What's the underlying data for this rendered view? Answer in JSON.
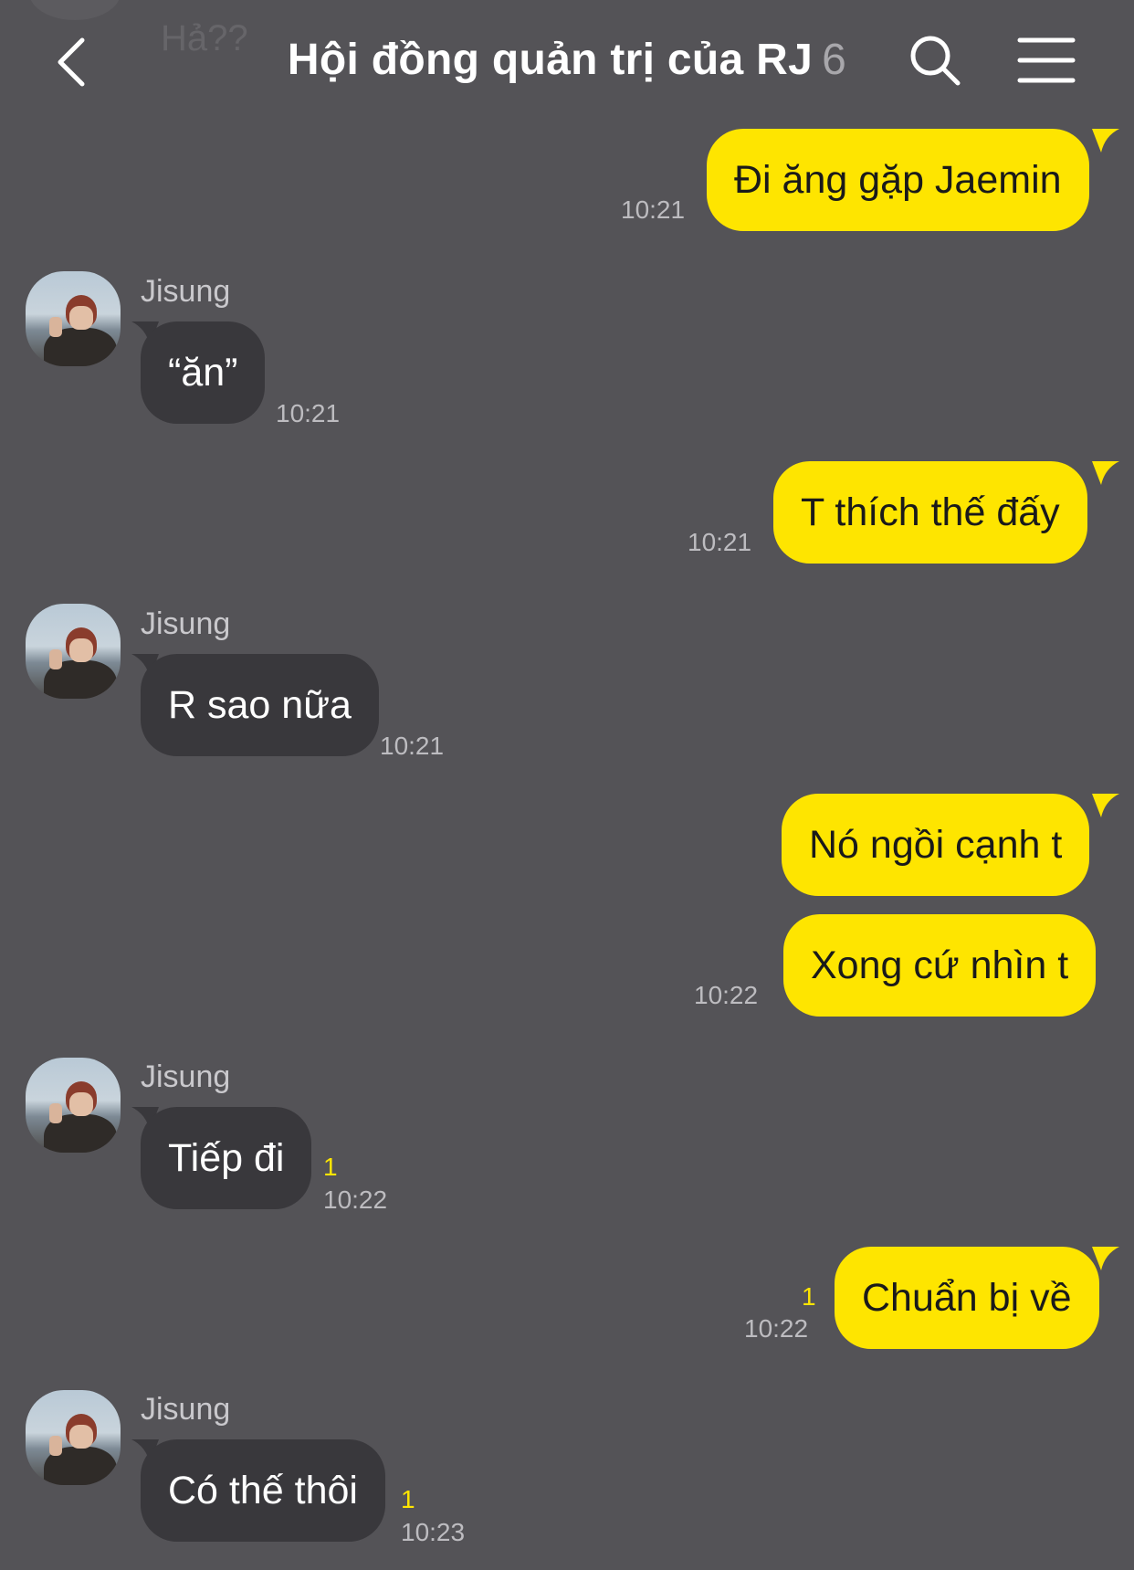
{
  "header": {
    "title": "Hội đồng quản trị của RJ",
    "member_count": "6",
    "ghost_previous_message": "Hả??"
  },
  "messages": [
    {
      "dir": "out",
      "text": "Đi ăng gặp Jaemin",
      "time": "10:21"
    },
    {
      "dir": "in",
      "sender": "Jisung",
      "text": "“ăn”",
      "time": "10:21"
    },
    {
      "dir": "out",
      "text": "T thích thế đấy",
      "time": "10:21"
    },
    {
      "dir": "in",
      "sender": "Jisung",
      "text": "R sao nữa",
      "time": "10:21"
    },
    {
      "dir": "out",
      "text": "Nó ngồi cạnh t"
    },
    {
      "dir": "out",
      "text": "Xong cứ nhìn t",
      "time": "10:22"
    },
    {
      "dir": "in",
      "sender": "Jisung",
      "text": "Tiếp đi",
      "time": "10:22",
      "unread": "1"
    },
    {
      "dir": "out",
      "text": "Chuẩn bị về",
      "time": "10:22",
      "unread": "1"
    },
    {
      "dir": "in",
      "sender": "Jisung",
      "text": "Có thế thôi",
      "time": "10:23",
      "unread": "1"
    }
  ],
  "colors": {
    "background": "#545357",
    "outgoing_bubble": "#fee500",
    "incoming_bubble": "#39383c",
    "unread_count": "#fee500"
  }
}
